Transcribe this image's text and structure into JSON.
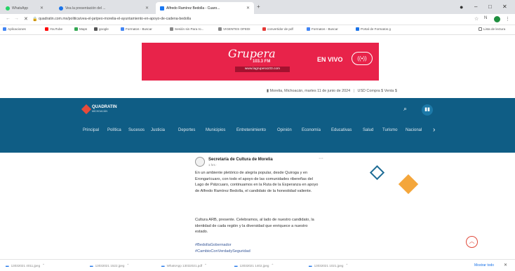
{
  "browser": {
    "tabs": [
      {
        "label": "WhatsApp",
        "icon": "whatsapp-icon",
        "color": "#25d366",
        "active": false
      },
      {
        "label": "Vea la presentación del ...",
        "icon": "globe-icon",
        "color": "#1a73e8",
        "active": false
      },
      {
        "label": "Alfredo Ramírez Bedolla - Cuaro...",
        "icon": "facebook-icon",
        "color": "#1877f2",
        "active": true
      }
    ],
    "new_tab_label": "+",
    "window_controls": {
      "minimize": "–",
      "maximize": "□",
      "close": "✕"
    },
    "back": "←",
    "forward": "→",
    "reload": "✕",
    "url": "quadratin.com.mx/politica/vea-el-jaripeo-morelia-el-ayuntamiento-en-apoyo-de-cadena-bedolla",
    "profile_initial": "N",
    "reading_list_label": "Lista de lectura"
  },
  "bookmarks": [
    {
      "label": "Aplicaciones",
      "color": "#4285f4"
    },
    {
      "label": "YouTube",
      "color": "#ff0000"
    },
    {
      "label": "Maps",
      "color": "#34a853"
    },
    {
      "label": "google",
      "color": "#555555"
    },
    {
      "label": "Formatos - Buscar",
      "color": "#4285f4"
    },
    {
      "label": "Sesión sin Para ro...",
      "color": "#888888"
    },
    {
      "label": "VIGENTES OFEDI",
      "color": "#888888"
    },
    {
      "label": "convertidor de pdf",
      "color": "#e53935"
    },
    {
      "label": "Formatos - Buscar",
      "color": "#4285f4"
    },
    {
      "label": "Portal de Formatos g",
      "color": "#1a73e8"
    }
  ],
  "banner": {
    "brand": "Grupera",
    "freq": "103.3 FM",
    "url": "www.lagrupera103.com",
    "cta": "EN VIVO",
    "color": "#e8234a"
  },
  "info_line": {
    "date": "Morelia, Michoacán, martes 11 de junio de 2024",
    "usd": "USD Compra $ Venta $"
  },
  "site": {
    "logo": "QUADRATIN",
    "logo_sub": "MICHOACÁN",
    "header_color": "#0f5d85",
    "nav": [
      "Principal",
      "Política",
      "Sucesos",
      "Justicia",
      "Deportes",
      "Municipios",
      "Entretenimiento",
      "Opinión",
      "Economía",
      "Educativas",
      "Salud",
      "Turismo",
      "Nacional"
    ]
  },
  "post": {
    "author": "Secretaría de Cultura de Morelia",
    "time": "1 hrs · ",
    "more": "···",
    "p1": "En un ambiente pletórico de alegría popular, desde Quiroga y en Erongarícuaro, con todo el apoyo de las comunidades ribereñas del Lago de Pátzcuaro, continuamos en la Ruta de la Esperanza en apoyo de Alfredo Ramírez Bedolla, el candidato de la honestidad valiente.",
    "p2": "Cultura ARB, presente. Celebramos, al lado de nuestro candidato, la identidad de cada región y la diversidad que enriquece a nuestro estado.",
    "tags": "#BedollaGobernador\n#CambioConVerdadySeguridad"
  },
  "downloads": [
    "13032021 4011.jpeg",
    "13032021 1522.jpeg",
    "WhatsApp 13032021.pdf",
    "13032021 1402.jpeg",
    "13032021 1021.jpeg"
  ],
  "downloads_show_all": "Mostrar todo"
}
